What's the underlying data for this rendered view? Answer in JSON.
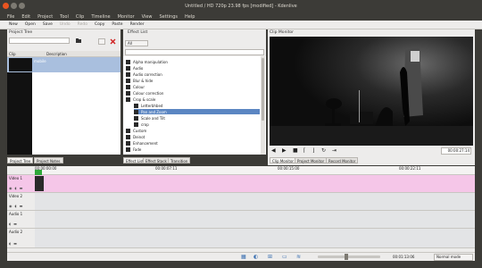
{
  "window": {
    "title": "Untitled / HD 720p 23.98 fps [modified] - Kdenlive",
    "colors": {
      "close": "#e95420",
      "minimize": "#7d7a72",
      "maximize": "#7d7a72",
      "accent": "#5b86c2",
      "clip_pink": "#f5c6e8"
    }
  },
  "menu": [
    "File",
    "Edit",
    "Project",
    "Tool",
    "Clip",
    "Timeline",
    "Monitor",
    "View",
    "Settings",
    "Help"
  ],
  "toolbar": {
    "items": [
      {
        "label": "New",
        "enabled": true
      },
      {
        "label": "Open",
        "enabled": true
      },
      {
        "label": "Save",
        "enabled": true
      },
      {
        "label": "Undo",
        "enabled": false
      },
      {
        "label": "Redo",
        "enabled": false
      },
      {
        "label": "Copy",
        "enabled": true
      },
      {
        "label": "Paste",
        "enabled": true
      },
      {
        "label": "Render",
        "enabled": true
      }
    ]
  },
  "project": {
    "title": "Project Tree",
    "search_placeholder": "",
    "col_clip": "Clip",
    "col_description": "Description",
    "clip_name": "mobile"
  },
  "effects": {
    "title": "Effect List",
    "filter_value": "All",
    "search_value": "",
    "items": [
      {
        "label": "Alpha manipulation",
        "level": 0,
        "selected": false,
        "icon": "folder-icon"
      },
      {
        "label": "Audio",
        "level": 0,
        "selected": false,
        "icon": "folder-icon"
      },
      {
        "label": "Audio correction",
        "level": 0,
        "selected": false,
        "icon": "folder-icon"
      },
      {
        "label": "Blur & hide",
        "level": 0,
        "selected": false,
        "icon": "folder-icon"
      },
      {
        "label": "Colour",
        "level": 0,
        "selected": false,
        "icon": "folder-icon"
      },
      {
        "label": "Colour correction",
        "level": 0,
        "selected": false,
        "icon": "folder-icon"
      },
      {
        "label": "Crop & scale",
        "level": 0,
        "selected": false,
        "icon": "folder-icon"
      },
      {
        "label": "Letterbhbed",
        "level": 1,
        "selected": false,
        "icon": "effect-icon"
      },
      {
        "label": "Pan and Zoom",
        "level": 1,
        "selected": true,
        "icon": "effect-icon"
      },
      {
        "label": "Scale and Tilt",
        "level": 1,
        "selected": false,
        "icon": "effect-icon"
      },
      {
        "label": "crop",
        "level": 1,
        "selected": false,
        "icon": "effect-icon"
      },
      {
        "label": "Custom",
        "level": 0,
        "selected": false,
        "icon": "folder-icon"
      },
      {
        "label": "Deinot",
        "level": 0,
        "selected": false,
        "icon": "folder-icon"
      },
      {
        "label": "Enhancement",
        "level": 0,
        "selected": false,
        "icon": "folder-icon"
      },
      {
        "label": "Fade",
        "level": 0,
        "selected": false,
        "icon": "folder-icon"
      }
    ]
  },
  "monitor": {
    "title": "Clip Monitor",
    "timecode": "00:00:27:14",
    "tabs": [
      "Clip Monitor",
      "Project Monitor",
      "Record Monitor"
    ]
  },
  "left_tabs": [
    "Project Tree",
    "Project Notes"
  ],
  "middle_tabs": [
    "Effect List",
    "Effect Stack",
    "Transition"
  ],
  "timeline": {
    "ruler": [
      "00:00:00:00",
      "00:00:07:11",
      "00:00:15:00",
      "00:00:22:11"
    ],
    "tracks": [
      {
        "name": "Video 1",
        "type": "video"
      },
      {
        "name": "Video 2",
        "type": "video"
      },
      {
        "name": "Audio 1",
        "type": "audio"
      },
      {
        "name": "Audio 2",
        "type": "audio"
      }
    ]
  },
  "status": {
    "timecode": "00:01:13:06",
    "mode": "Normal mode"
  }
}
